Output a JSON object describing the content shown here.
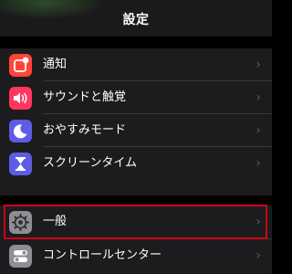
{
  "nav": {
    "title": "設定"
  },
  "groups": {
    "primary": [
      {
        "label": "通知",
        "icon": "notifications-icon",
        "icon_color": "#ff453a"
      },
      {
        "label": "サウンドと触覚",
        "icon": "speaker-icon",
        "icon_color": "#ff375f"
      },
      {
        "label": "おやすみモード",
        "icon": "moon-icon",
        "icon_color": "#5e5ce6"
      },
      {
        "label": "スクリーンタイム",
        "icon": "hourglass-icon",
        "icon_color": "#5e5ce6"
      }
    ],
    "secondary": [
      {
        "label": "一般",
        "icon": "gear-icon",
        "icon_color": "#8e8e93",
        "highlighted": true
      },
      {
        "label": "コントロールセンター",
        "icon": "toggles-icon",
        "icon_color": "#8e8e93"
      }
    ]
  },
  "colors": {
    "background": "#000000",
    "cell": "#1c1c1e",
    "separator": "#38383a",
    "chevron": "#5a5a5e",
    "highlight_border": "#d0021b"
  },
  "chevron_glyph": "›"
}
